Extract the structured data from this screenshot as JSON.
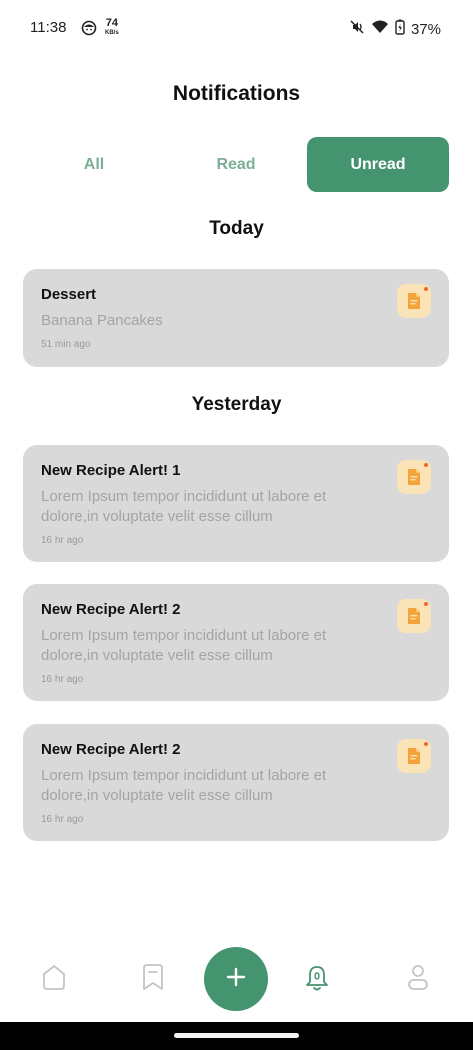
{
  "status_bar": {
    "time": "11:38",
    "net_speed_value": "74",
    "net_speed_unit": "KB/s",
    "battery_percent": "37%"
  },
  "header": {
    "title": "Notifications"
  },
  "tabs": [
    {
      "label": "All",
      "active": false
    },
    {
      "label": "Read",
      "active": false
    },
    {
      "label": "Unread",
      "active": true
    }
  ],
  "sections": {
    "today": "Today",
    "yesterday": "Yesterday"
  },
  "notifications": [
    {
      "title": "Dessert",
      "body": "Banana Pancakes",
      "time": "51 min ago"
    },
    {
      "title": "New Recipe Alert! 1",
      "body": "Lorem Ipsum tempor incididunt ut labore et dolore,in voluptate velit esse cillum",
      "time": "16 hr ago"
    },
    {
      "title": "New Recipe Alert! 2",
      "body": "Lorem Ipsum tempor incididunt ut labore et dolore,in voluptate velit esse cillum",
      "time": "16 hr ago"
    },
    {
      "title": "New Recipe Alert! 2",
      "body": "Lorem Ipsum tempor incididunt ut labore et dolore,in voluptate velit esse cillum",
      "time": "16 hr ago"
    }
  ],
  "icons": {
    "notification": "recipe-document-icon",
    "nav_home": "home-icon",
    "nav_saved": "bookmark-icon",
    "nav_add": "plus-icon",
    "nav_notifications": "bell-icon",
    "nav_profile": "profile-icon"
  },
  "colors": {
    "accent": "#44946f",
    "tab_inactive": "#7fae98",
    "card_bg": "#d9d9d9",
    "icon_bg": "#fbe3b8",
    "icon_fg": "#f2a33a",
    "unread_dot": "#ef6b2b"
  }
}
